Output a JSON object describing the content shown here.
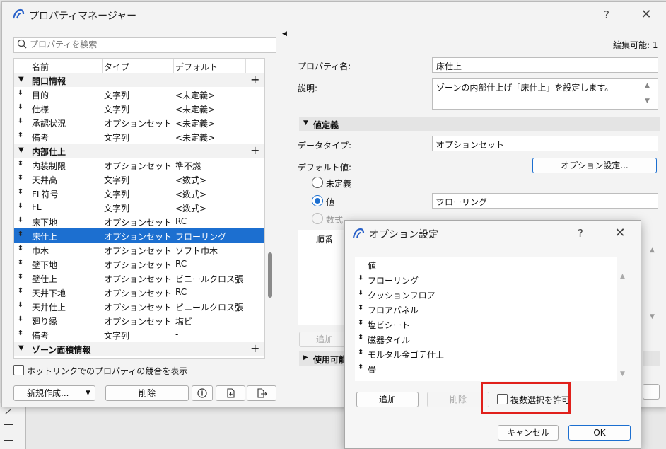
{
  "app": {
    "title": "プロパティマネージャー",
    "help": "?",
    "close": "✕"
  },
  "left": {
    "search_placeholder": "プロパティを検索",
    "columns": [
      "名前",
      "タイプ",
      "デフォルト"
    ],
    "groups": [
      {
        "label": "開口情報",
        "rows": [
          {
            "name": "目的",
            "type": "文字列",
            "default": "<未定義>"
          },
          {
            "name": "仕様",
            "type": "文字列",
            "default": "<未定義>"
          },
          {
            "name": "承認状況",
            "type": "オプションセット",
            "default": "<未定義>"
          },
          {
            "name": "備考",
            "type": "文字列",
            "default": "<未定義>"
          }
        ]
      },
      {
        "label": "内部仕上",
        "rows": [
          {
            "name": "内装制限",
            "type": "オプションセット",
            "default": "準不燃"
          },
          {
            "name": "天井高",
            "type": "文字列",
            "default": "<数式>"
          },
          {
            "name": "FL符号",
            "type": "文字列",
            "default": "<数式>"
          },
          {
            "name": "FL",
            "type": "文字列",
            "default": "<数式>"
          },
          {
            "name": "床下地",
            "type": "オプションセット",
            "default": "RC"
          },
          {
            "name": "床仕上",
            "type": "オプションセット",
            "default": "フローリング",
            "selected": true
          },
          {
            "name": "巾木",
            "type": "オプションセット",
            "default": "ソフト巾木"
          },
          {
            "name": "壁下地",
            "type": "オプションセット",
            "default": "RC"
          },
          {
            "name": "壁仕上",
            "type": "オプションセット",
            "default": "ビニールクロス張"
          },
          {
            "name": "天井下地",
            "type": "オプションセット",
            "default": "RC"
          },
          {
            "name": "天井仕上",
            "type": "オプションセット",
            "default": "ビニールクロス張"
          },
          {
            "name": "廻り縁",
            "type": "オプションセット",
            "default": "塩ビ"
          },
          {
            "name": "備考",
            "type": "文字列",
            "default": "-"
          }
        ]
      },
      {
        "label": "ゾーン面積情報",
        "rows": []
      }
    ],
    "hotlink_checkbox": "ホットリンクでのプロパティの競合を表示",
    "new_button": "新規作成...",
    "delete_button": "削除"
  },
  "right": {
    "editable": "編集可能: 1",
    "property_name_label": "プロパティ名:",
    "property_name_value": "床仕上",
    "description_label": "説明:",
    "description_value": "ゾーンの内部仕上げ「床仕上」を設定します。",
    "value_definition_section": "値定義",
    "data_type_label": "データタイプ:",
    "data_type_value": "オプションセット",
    "default_value_label": "デフォルト値:",
    "option_settings_button": "オプション設定...",
    "radio_undefined": "未定義",
    "radio_value": "値",
    "radio_value_selected": "フローリング",
    "radio_formula": "数式",
    "order_label": "順番",
    "add_partial": "追加",
    "available_section": "使用可能"
  },
  "dialog": {
    "title": "オプション設定",
    "help": "?",
    "close": "✕",
    "list_header": "値",
    "options": [
      "フローリング",
      "クッションフロア",
      "フロアパネル",
      "塩ビシート",
      "磁器タイル",
      "モルタル金ゴテ仕上",
      "畳"
    ],
    "add_button": "追加",
    "delete_button": "削除",
    "multi_select_label": "複数選択を許可",
    "cancel_button": "キャンセル",
    "ok_button": "OK"
  },
  "colors": {
    "selection": "#1c6fd0",
    "highlight_box": "#e0201b"
  }
}
